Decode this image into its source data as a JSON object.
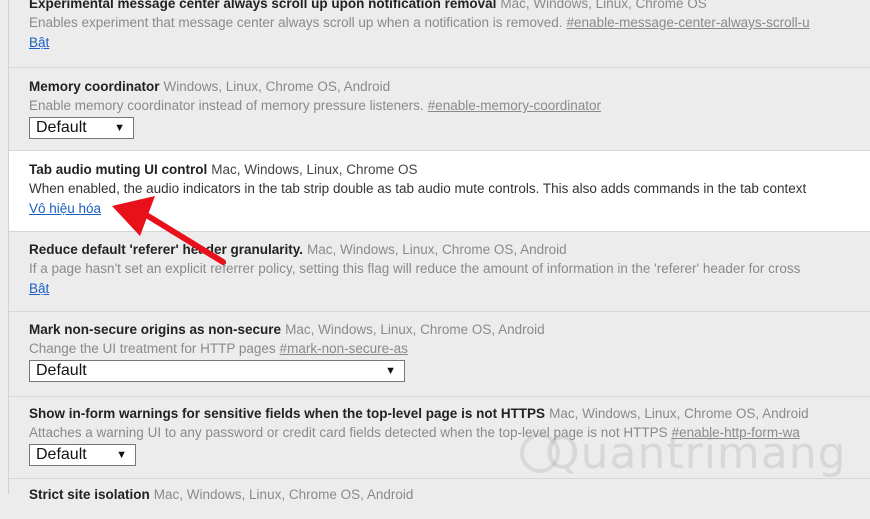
{
  "experiments": [
    {
      "name": "Experimental message center always scroll up upon notification removal",
      "platforms": "Mac, Windows, Linux, Chrome OS",
      "description": "Enables experiment that message center always scroll up when a notification is removed.",
      "hash": "#enable-message-center-always-scroll-u",
      "action": "Bật"
    },
    {
      "name": "Memory coordinator",
      "platforms": "Windows, Linux, Chrome OS, Android",
      "description": "Enable memory coordinator instead of memory pressure listeners.",
      "hash": "#enable-memory-coordinator",
      "select": "Default"
    },
    {
      "name": "Tab audio muting UI control",
      "platforms": "Mac, Windows, Linux, Chrome OS",
      "description": "When enabled, the audio indicators in the tab strip double as tab audio mute controls. This also adds commands in the tab context",
      "action": "Vô hiệu hóa"
    },
    {
      "name": "Reduce default 'referer' header granularity.",
      "platforms": "Mac, Windows, Linux, Chrome OS, Android",
      "description": "If a page hasn't set an explicit referrer policy, setting this flag will reduce the amount of information in the 'referer' header for cross",
      "action": "Bật"
    },
    {
      "name": "Mark non-secure origins as non-secure",
      "platforms": "Mac, Windows, Linux, Chrome OS, Android",
      "description": "Change the UI treatment for HTTP pages",
      "hash": "#mark-non-secure-as",
      "select": "Default"
    },
    {
      "name": "Show in-form warnings for sensitive fields when the top-level page is not HTTPS",
      "platforms": "Mac, Windows, Linux, Chrome OS, Android",
      "description": "Attaches a warning UI to any password or credit card fields detected when the top-level page is not HTTPS",
      "hash": "#enable-http-form-wa",
      "select": "Default"
    },
    {
      "name": "Strict site isolation",
      "platforms": "Mac, Windows, Linux, Chrome OS, Android"
    }
  ],
  "watermark": "Quantrimang",
  "colors": {
    "annotation_arrow": "#e8101a",
    "link": "#1a5fc4",
    "active_row_bg": "#ffffff",
    "inactive_row_bg": "#ececec"
  }
}
